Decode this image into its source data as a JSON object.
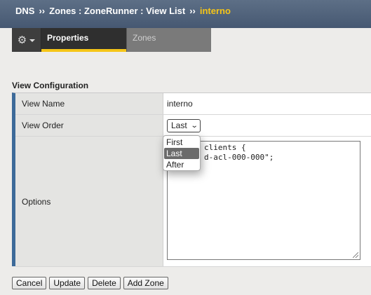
{
  "breadcrumb": {
    "items": [
      "DNS",
      "Zones : ZoneRunner : View List"
    ],
    "separator": "››",
    "current": "interno"
  },
  "tabs": {
    "gear_icon": "gear-icon",
    "items": [
      {
        "label": "Properties",
        "active": true
      },
      {
        "label": "Zones",
        "active": false
      }
    ]
  },
  "section": {
    "title": "View Configuration"
  },
  "form": {
    "view_name": {
      "label": "View Name",
      "value": "interno"
    },
    "view_order": {
      "label": "View Order",
      "selected": "Last",
      "options": [
        "First",
        "Last",
        "After"
      ]
    },
    "options": {
      "label": "Options",
      "text_visible_line1": "clients {",
      "text_visible_line2": "d-acl-000-000\";"
    }
  },
  "buttons": {
    "cancel": "Cancel",
    "update": "Update",
    "delete": "Delete",
    "add_zone": "Add Zone"
  },
  "colors": {
    "header_bg": "#4f6179",
    "accent_yellow": "#f5c518",
    "row_marker": "#3d6a99"
  }
}
